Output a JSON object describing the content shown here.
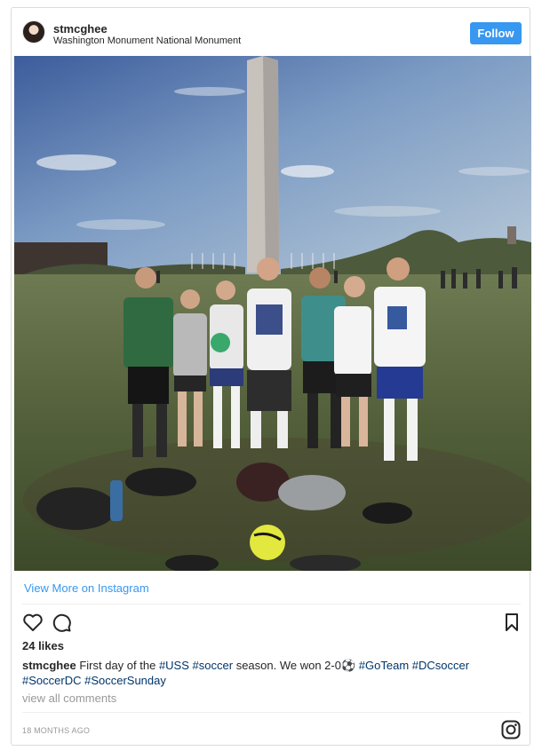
{
  "post": {
    "username": "stmcghee",
    "location": "Washington Monument National Monument",
    "follow_label": "Follow",
    "photo_alt": "Soccer team posing in front of the Washington Monument",
    "view_more": "View More on Instagram",
    "likes": "24 likes",
    "caption": {
      "user": "stmcghee",
      "text1": "First day of the",
      "tag_uss": "#USS",
      "tag_soccer": "#soccer",
      "text2": "season. We won 2-0⚽",
      "tag_goteam": "#GoTeam",
      "tag_dcsoccer": "#DCsoccer",
      "tag_soccerdc": "#SoccerDC",
      "tag_soccersunday": "#SoccerSunday"
    },
    "view_comments": "view all comments",
    "timestamp": "18 MONTHS AGO"
  },
  "colors": {
    "accent": "#3897f0",
    "hashtag": "#003569",
    "muted": "#999999",
    "text": "#262626",
    "border": "#dbdbdb"
  },
  "icons": [
    "heart-icon",
    "comment-icon",
    "bookmark-icon",
    "instagram-logo-icon"
  ]
}
